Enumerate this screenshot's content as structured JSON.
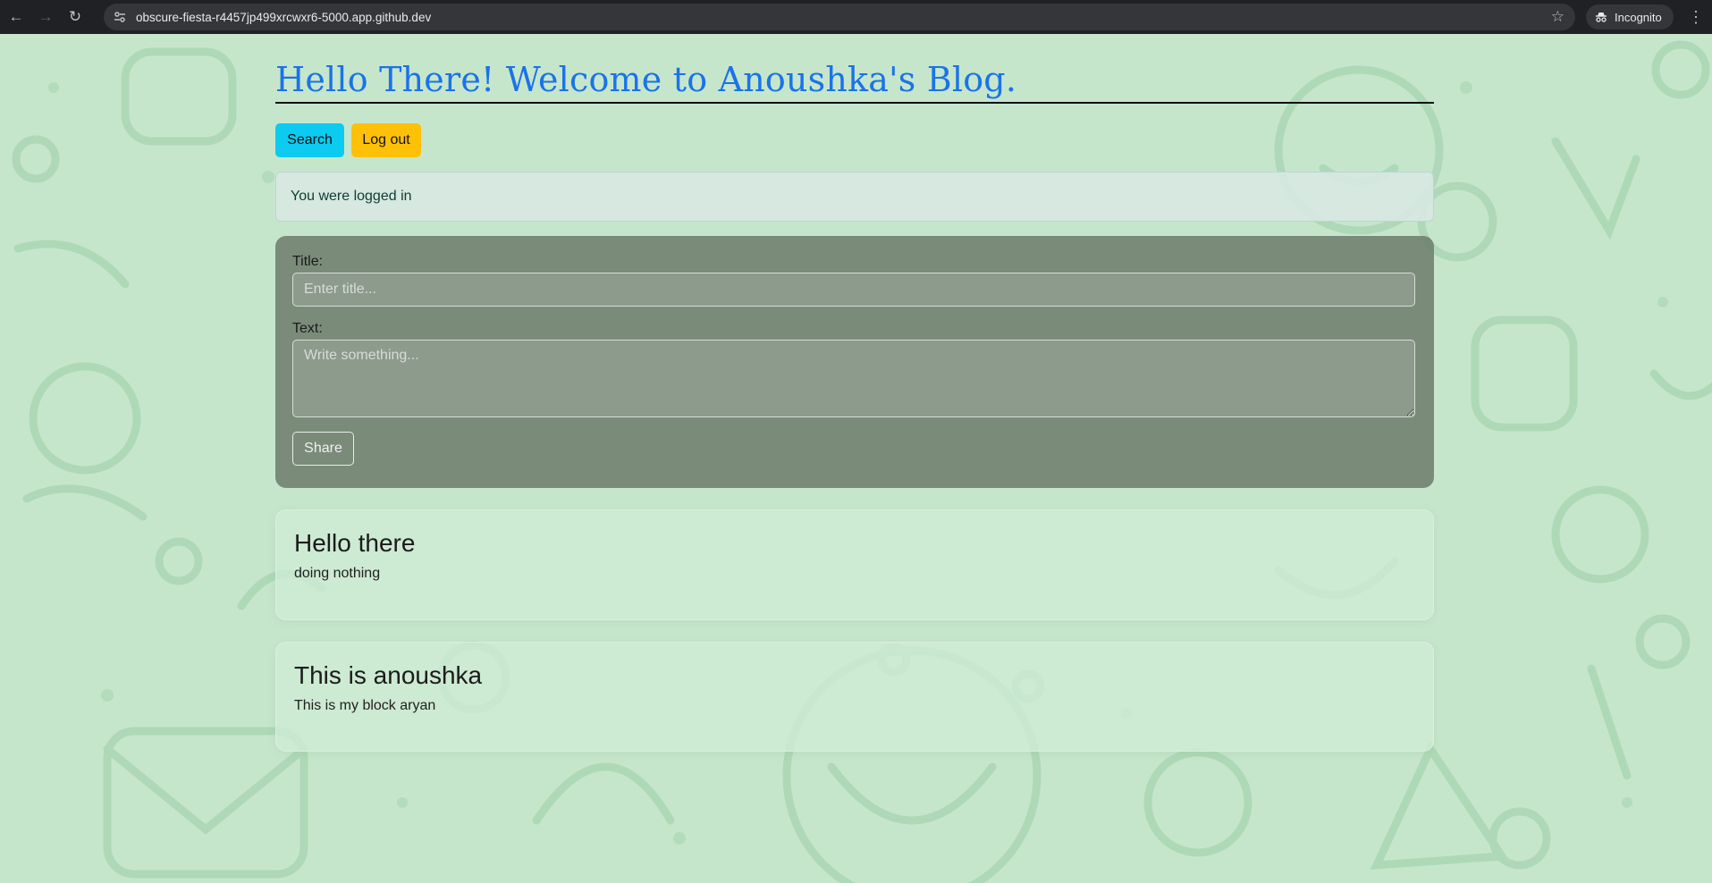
{
  "browser": {
    "url": "obscure-fiesta-r4457jp499xrcwxr6-5000.app.github.dev",
    "incognito_label": "Incognito"
  },
  "page": {
    "title": "Hello There! Welcome to Anoushka's Blog.",
    "buttons": {
      "search": "Search",
      "logout": "Log out"
    },
    "alert": "You were logged in",
    "form": {
      "title_label": "Title:",
      "title_placeholder": "Enter title...",
      "text_label": "Text:",
      "text_placeholder": "Write something...",
      "submit": "Share"
    },
    "posts": [
      {
        "title": "Hello there",
        "text": "doing nothing"
      },
      {
        "title": "This is anoushka",
        "text": "This is my block aryan"
      }
    ]
  },
  "colors": {
    "background": "#c6e6cc",
    "title": "#1a73e8",
    "search_button": "#0dcaf0",
    "logout_button": "#ffc107"
  }
}
